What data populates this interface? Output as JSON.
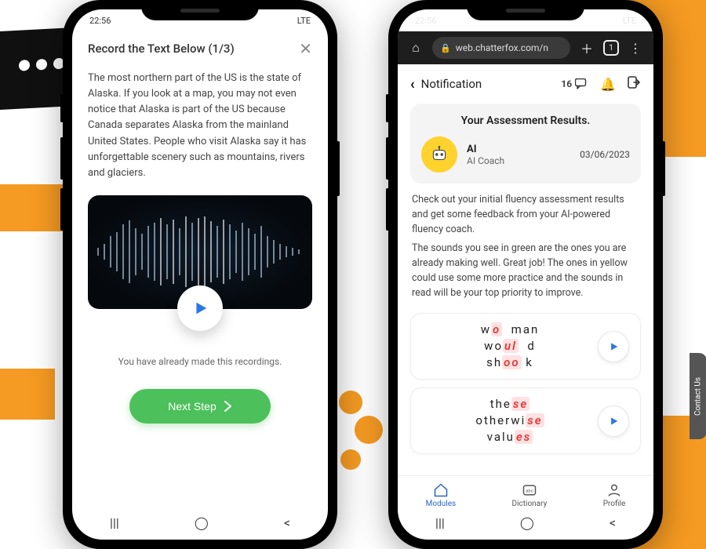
{
  "status_time": "22:56",
  "status_right": "LTE",
  "left_phone": {
    "title": "Record the Text Below (1/3)",
    "body_text": "The most northern part of the US is the state of Alaska. If you look at a map, you may not even notice that Alaska is part of the US because Canada separates Alaska from the mainland United States. People who visit Alaska say it has unforgettable scenery such as mountains, rivers and glaciers.",
    "already_msg": "You have already made this recordings.",
    "next_btn": "Next Step"
  },
  "right_phone": {
    "url": "web.chatterfox.com/n",
    "page_title": "Notification",
    "msg_count": "16",
    "card_heading": "Your Assessment Results.",
    "ai_name": "AI",
    "ai_role": "AI Coach",
    "date": "03/06/2023",
    "para1": "Check out your initial fluency assessment results and get some feedback from your AI-powered fluency coach.",
    "para2": "The sounds you see in green are the ones you are already making well. Great job! The ones in yellow could use some more practice and the sounds in read will be your top priority to improve.",
    "words1": [
      {
        "pre": "w",
        "hl": "o",
        "post": "  man"
      },
      {
        "pre": "wo",
        "hl": "ul",
        "post": "  d"
      },
      {
        "pre": "sh",
        "hl": "oo",
        "post": " k"
      }
    ],
    "words2": [
      {
        "pre": "the",
        "hl": "se",
        "post": ""
      },
      {
        "pre": "otherwi",
        "hl": "se",
        "post": ""
      },
      {
        "pre": "valu",
        "hl": "es",
        "post": ""
      }
    ],
    "tabs": {
      "modules": "Modules",
      "dictionary": "Dictionary",
      "profile": "Profile"
    },
    "contact": "Contact Us"
  }
}
